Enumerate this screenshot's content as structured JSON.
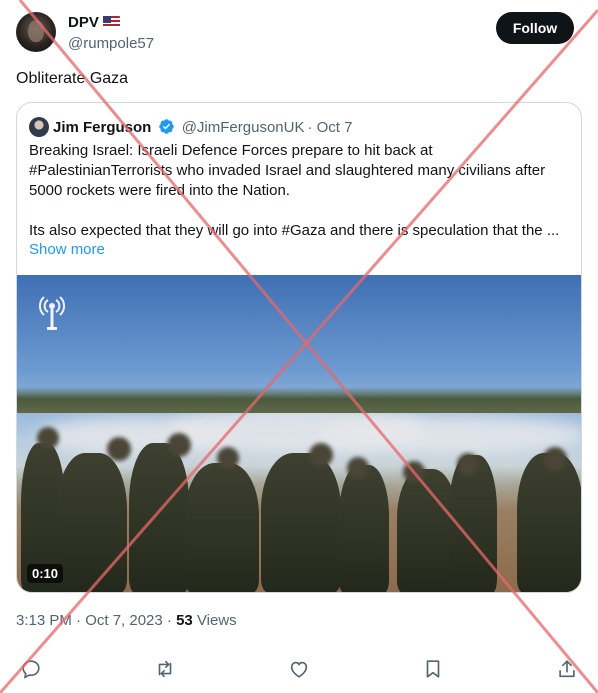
{
  "author": {
    "display_name": "DPV",
    "flag_icon": "us-flag-icon",
    "handle": "@rumpole57"
  },
  "follow_button_label": "Follow",
  "tweet_text": "Obliterate Gaza",
  "quoted_tweet": {
    "display_name": "Jim Ferguson",
    "verified_icon": "verified-badge-icon",
    "handle": "@JimFergusonUK",
    "date": "· Oct 7",
    "paragraph_1": "Breaking Israel: Israeli Defence Forces prepare to hit back at #PalestinianTerrorists who invaded Israel and slaughtered many civilians after 5000 rockets were fired into the Nation.",
    "paragraph_2": "Its also expected that they will go into #Gaza and there is speculation that the ...",
    "show_more": "Show more",
    "video": {
      "duration": "0:10",
      "logo_icon": "idf-logo-icon"
    }
  },
  "timestamp": "3:13 PM · Oct 7, 2023 ·",
  "views": {
    "count": "53",
    "label": "Views"
  },
  "actions": [
    "reply-icon",
    "retweet-icon",
    "like-icon",
    "bookmark-icon",
    "share-icon"
  ],
  "colors": {
    "accent": "#1d9bf0",
    "text_secondary": "#536471",
    "overlay_cross": "#e8686b"
  }
}
